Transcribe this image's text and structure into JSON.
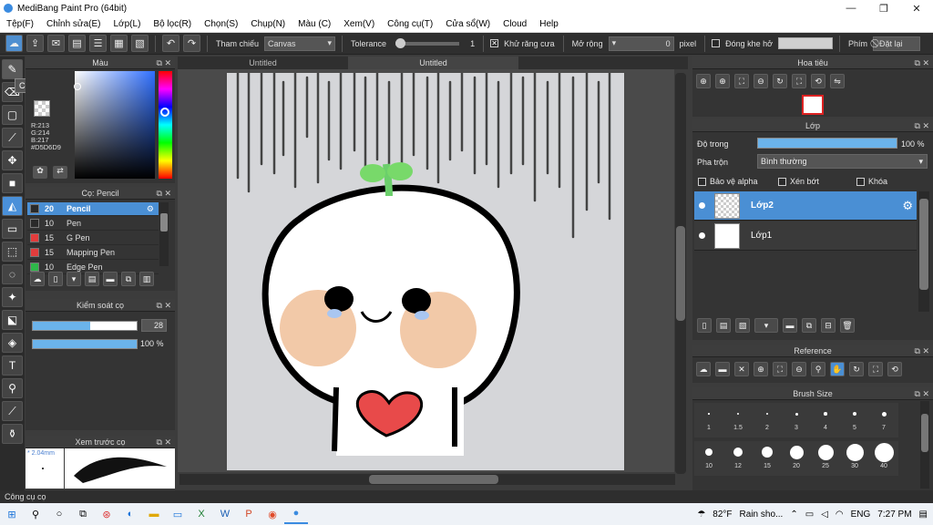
{
  "window": {
    "title": "MediBang Paint Pro (64bit)",
    "minimize": "—",
    "maximize": "❐",
    "close": "✕"
  },
  "menu": [
    "Tệp(F)",
    "Chỉnh sửa(E)",
    "Lớp(L)",
    "Bộ lọc(R)",
    "Chọn(S)",
    "Chụp(N)",
    "Màu (C)",
    "Xem(V)",
    "Công cụ(T)",
    "Cửa sổ(W)",
    "Cloud",
    "Help"
  ],
  "toolbar": {
    "reference_label": "Tham chiếu",
    "reference_value": "Canvas",
    "tolerance_label": "Tolerance",
    "tolerance_value": "1",
    "antialias_label": "Khử răng cưa",
    "expand_label": "Mở rộng",
    "expand_value": "0",
    "expand_unit": "pixel",
    "gap_label": "Đóng khe hở",
    "key_label": "Phím",
    "reset_label": "Đặt lại"
  },
  "tooltip": "Công cụ cọ",
  "color_panel": {
    "title": "Màu",
    "r": "R:213",
    "g": "G:214",
    "b": "B:217",
    "hex": "#D5D6D9",
    "current_color": "#D5D6D9"
  },
  "brush_panel": {
    "title": "Cọ: Pencil",
    "brushes": [
      {
        "size": "20",
        "name": "Pencil",
        "color": "#2a2a2a",
        "selected": true
      },
      {
        "size": "10",
        "name": "Pen",
        "color": "#2a2a2a",
        "selected": false
      },
      {
        "size": "15",
        "name": "G Pen",
        "color": "#e23c3c",
        "selected": false
      },
      {
        "size": "15",
        "name": "Mapping Pen",
        "color": "#e23c3c",
        "selected": false
      },
      {
        "size": "10",
        "name": "Edge Pen",
        "color": "#2fb84a",
        "selected": false
      }
    ]
  },
  "brush_control": {
    "title": "Kiểm soát cọ",
    "size_value": "28",
    "opacity_value": "100 %",
    "size_fraction": 0.55,
    "opacity_fraction": 1.0
  },
  "preview": {
    "title": "Xem trước cọ",
    "size_text": "* 2.04mm"
  },
  "tabs": [
    "Untitled",
    "Untitled"
  ],
  "navigator": {
    "title": "Hoa tiêu"
  },
  "layer_panel": {
    "title": "Lớp",
    "opacity_label": "Độ trong",
    "opacity_value": "100 %",
    "blend_label": "Pha trộn",
    "blend_value": "Bình thường",
    "protect_alpha": "Bảo vệ alpha",
    "clipping": "Xén bớt",
    "lock": "Khóa",
    "layers": [
      {
        "name": "Lớp2",
        "selected": true
      },
      {
        "name": "Lớp1",
        "selected": false
      }
    ]
  },
  "reference_panel": {
    "title": "Reference"
  },
  "brush_size_panel": {
    "title": "Brush Size",
    "sizes": [
      "1",
      "1.5",
      "2",
      "3",
      "4",
      "5",
      "7",
      "10",
      "12",
      "15",
      "20",
      "25",
      "30",
      "40"
    ]
  },
  "status": "Công cụ cọ",
  "taskbar": {
    "weather_temp": "82°F",
    "weather_text": "Rain sho...",
    "lang": "ENG",
    "time": "7:27 PM"
  }
}
